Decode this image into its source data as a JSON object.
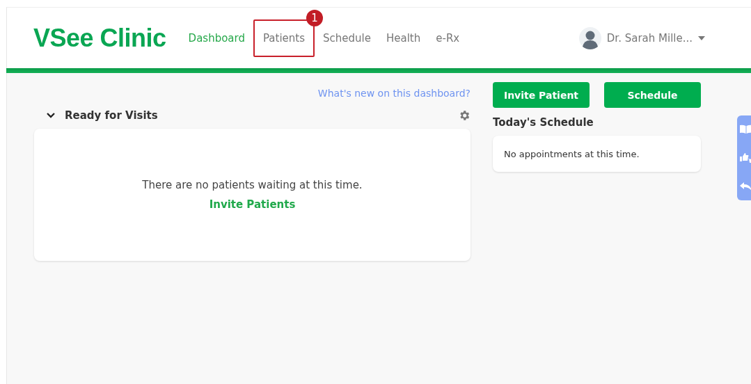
{
  "header": {
    "logo": "VSee Clinic",
    "nav": [
      {
        "label": "Dashboard",
        "selected": true,
        "highlighted": false
      },
      {
        "label": "Patients",
        "selected": false,
        "highlighted": true
      },
      {
        "label": "Schedule",
        "selected": false,
        "highlighted": false
      },
      {
        "label": "Health",
        "selected": false,
        "highlighted": false
      },
      {
        "label": "e-Rx",
        "selected": false,
        "highlighted": false
      }
    ],
    "callout_badge": "1",
    "user": {
      "name": "Dr. Sarah Mille..."
    }
  },
  "whats_new_link": "What's new on this dashboard?",
  "buttons": [
    "Invite Patient",
    "Schedule"
  ],
  "ready_for_visits": {
    "title": "Ready for Visits",
    "expanded": true,
    "empty_message": "There are no patients waiting at this time.",
    "invite_link": "Invite Patients"
  },
  "todays_schedule": {
    "title": "Today's Schedule",
    "empty_message": "No appointments at this time."
  }
}
